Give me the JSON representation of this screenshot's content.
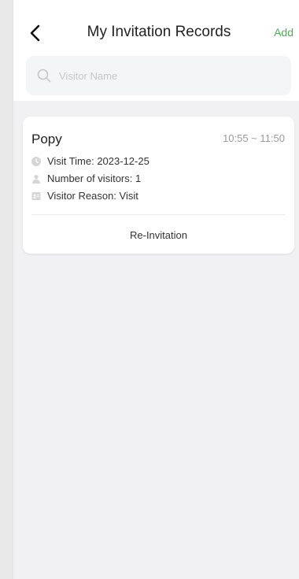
{
  "header": {
    "title": "My Invitation Records",
    "add_label": "Add"
  },
  "search": {
    "placeholder": "Visitor Name",
    "value": ""
  },
  "records": [
    {
      "name": "Popy",
      "time_range": "10:55 ~ 11:50",
      "visit_time": "Visit Time: 2023-12-25",
      "number_of_visitors": "Number of visitors:  1",
      "visitor_reason": "Visitor Reason: Visit",
      "action_label": "Re-Invitation"
    }
  ],
  "colors": {
    "accent": "#4caf50",
    "icon_gray": "#d3d3d3",
    "background": "#f1f1f3"
  },
  "icons": {
    "back": "chevron-left-icon",
    "search": "search-icon",
    "visit_time": "clock-icon",
    "visitors": "person-icon",
    "reason": "id-card-icon"
  }
}
